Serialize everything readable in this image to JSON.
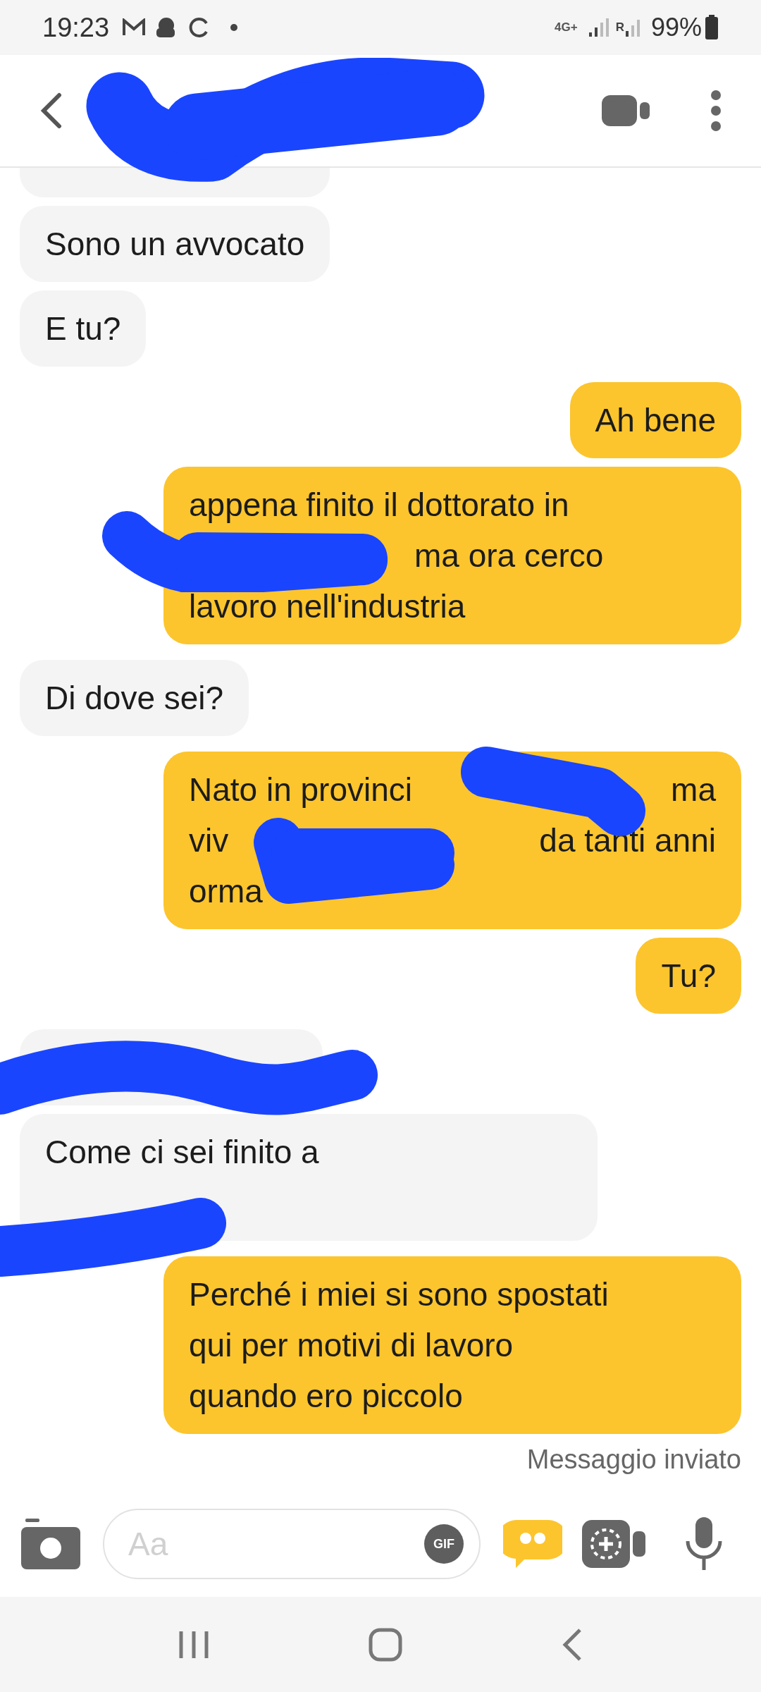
{
  "status_bar": {
    "time": "19:23",
    "network": "4G+",
    "roaming": "R",
    "battery": "99%"
  },
  "composer": {
    "placeholder": "Aa",
    "gif": "GIF"
  },
  "delivery_status": "Messaggio inviato",
  "messages": [
    {
      "kind": "received",
      "lines": [
        {
          "kind": "hidden"
        }
      ]
    },
    {
      "kind": "received",
      "lines": [
        {
          "kind": "plain",
          "parts": [
            "Sono un avvocato"
          ]
        }
      ]
    },
    {
      "kind": "received",
      "lines": [
        {
          "kind": "plain",
          "parts": [
            "E tu?"
          ]
        }
      ]
    },
    {
      "kind": "sent",
      "lines": [
        {
          "kind": "plain",
          "parts": [
            "Ah bene"
          ]
        }
      ]
    },
    {
      "kind": "sent",
      "lines": [
        {
          "kind": "plain",
          "parts": [
            "appena finito il dottorato in"
          ]
        },
        {
          "kind": "indented",
          "parts": [
            "ma ora cerco"
          ]
        },
        {
          "kind": "plain",
          "parts": [
            "lavoro nell'industria"
          ]
        }
      ]
    },
    {
      "kind": "received",
      "lines": [
        {
          "kind": "plain",
          "parts": [
            "Di dove sei?"
          ]
        }
      ]
    },
    {
      "kind": "sent",
      "lines": [
        {
          "kind": "split",
          "parts": [
            "Nato in provinci",
            "ma"
          ]
        },
        {
          "kind": "split",
          "parts": [
            "viv",
            "da tanti anni"
          ]
        },
        {
          "kind": "plain",
          "parts": [
            "orma"
          ]
        }
      ]
    },
    {
      "kind": "sent",
      "lines": [
        {
          "kind": "plain",
          "parts": [
            "Tu?"
          ]
        }
      ]
    },
    {
      "kind": "received",
      "lines": [
        {
          "kind": "hidden"
        }
      ]
    },
    {
      "kind": "received",
      "lines": [
        {
          "kind": "plain",
          "parts": [
            "Come ci sei finito a"
          ]
        },
        {
          "kind": "hidden"
        }
      ]
    },
    {
      "kind": "sent",
      "lines": [
        {
          "kind": "plain",
          "parts": [
            "Perché i miei si sono spostati"
          ]
        },
        {
          "kind": "plain",
          "parts": [
            "qui per motivi di lavoro"
          ]
        },
        {
          "kind": "plain",
          "parts": [
            "quando ero piccolo"
          ]
        }
      ]
    }
  ]
}
